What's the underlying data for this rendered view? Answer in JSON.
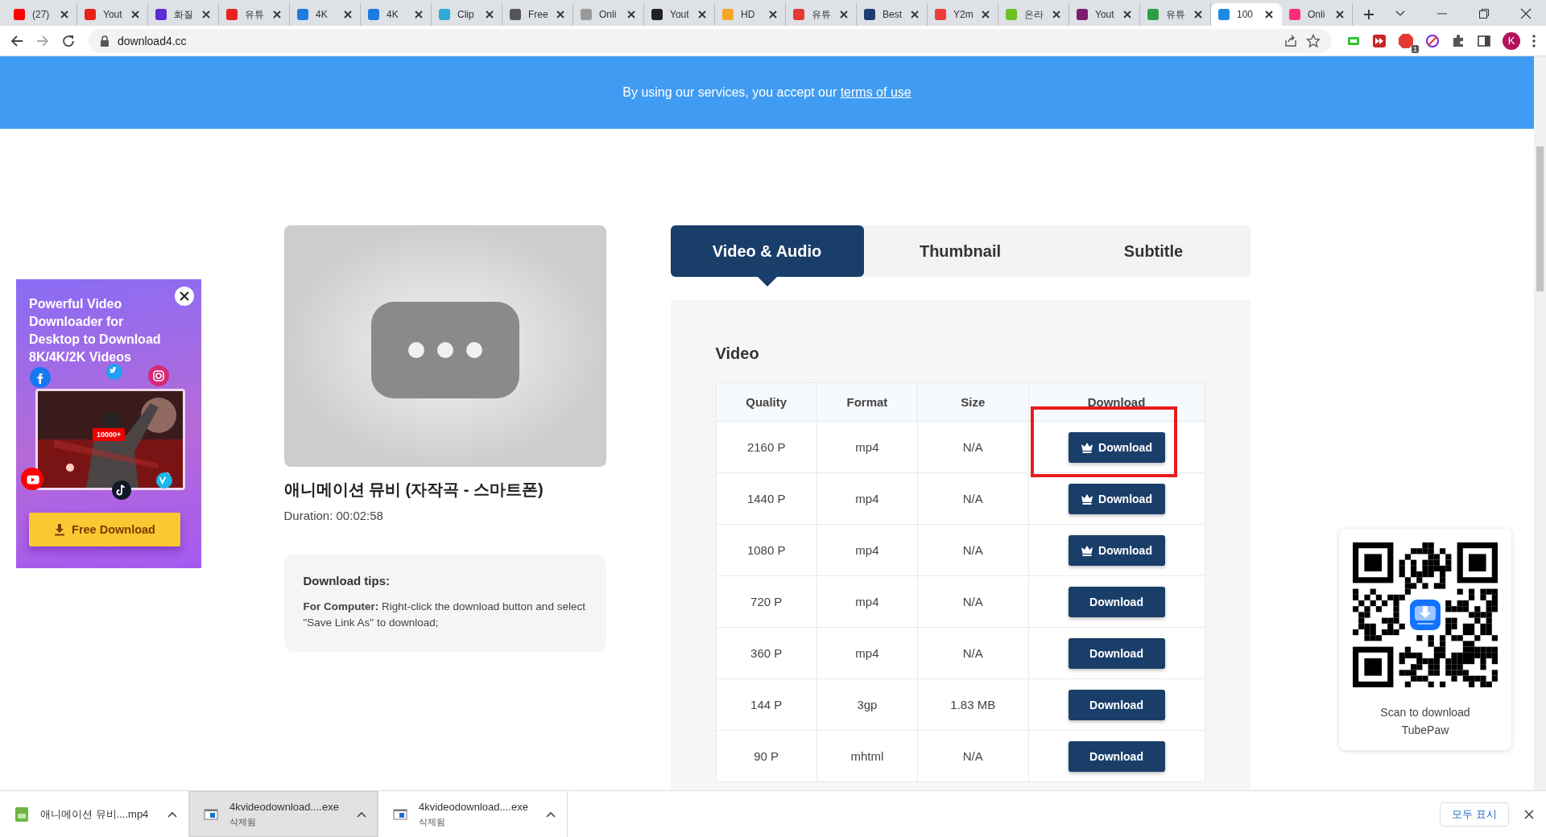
{
  "browser": {
    "tabs": [
      {
        "label": "(27)",
        "selected": false,
        "color": "#ff0000"
      },
      {
        "label": "Yout",
        "selected": false,
        "color": "#e62117"
      },
      {
        "label": "화질",
        "selected": false,
        "color": "#5b2bd6"
      },
      {
        "label": "유튜",
        "selected": false,
        "color": "#e8231d"
      },
      {
        "label": "4K",
        "selected": false,
        "color": "#1e7be0"
      },
      {
        "label": "4K",
        "selected": false,
        "color": "#1e7be0"
      },
      {
        "label": "Clip",
        "selected": false,
        "color": "#2fa9d9"
      },
      {
        "label": "Free",
        "selected": false,
        "color": "#555555"
      },
      {
        "label": "Onli",
        "selected": false,
        "color": "#9a9a9a"
      },
      {
        "label": "Yout",
        "selected": false,
        "color": "#222222"
      },
      {
        "label": "HD",
        "selected": false,
        "color": "#f5a623"
      },
      {
        "label": "유튜",
        "selected": false,
        "color": "#e53935"
      },
      {
        "label": "Best",
        "selected": false,
        "color": "#1f3b73"
      },
      {
        "label": "Y2m",
        "selected": false,
        "color": "#ef3b3b"
      },
      {
        "label": "온라",
        "selected": false,
        "color": "#6cc024"
      },
      {
        "label": "Yout",
        "selected": false,
        "color": "#7a1f6e"
      },
      {
        "label": "유튜",
        "selected": false,
        "color": "#2e9e44"
      },
      {
        "label": "100",
        "selected": true,
        "color": "#1e88e5"
      },
      {
        "label": "Onli",
        "selected": false,
        "color": "#ff2d7a"
      }
    ],
    "url": "download4.cc",
    "extension_badge": "1",
    "profile_initial": "K"
  },
  "banner": {
    "text": "By using our services, you accept our",
    "link": "terms of use"
  },
  "ad": {
    "headline": "Powerful Video Downloader for Desktop to Download 8K/4K/2K Videos",
    "badge": "10000+",
    "button": "Free Download"
  },
  "video": {
    "title": "애니메이션 뮤비 (자작곡 - 스마트폰)",
    "duration": "Duration: 00:02:58"
  },
  "tips": {
    "heading": "Download tips:",
    "text": "**For Computer:** Right-click the download button and select \"Save Link As\" to download;"
  },
  "format_tabs": [
    {
      "label": "Video & Audio",
      "selected": true
    },
    {
      "label": "Thumbnail",
      "selected": false
    },
    {
      "label": "Subtitle",
      "selected": false
    }
  ],
  "video_section": {
    "heading": "Video",
    "columns": [
      "Quality",
      "Format",
      "Size",
      "Download"
    ],
    "rows": [
      {
        "quality": "2160 P",
        "format": "mp4",
        "size": "N/A",
        "button": "Download",
        "premium": true,
        "highlighted": true
      },
      {
        "quality": "1440 P",
        "format": "mp4",
        "size": "N/A",
        "button": "Download",
        "premium": true,
        "highlighted": false
      },
      {
        "quality": "1080 P",
        "format": "mp4",
        "size": "N/A",
        "button": "Download",
        "premium": true,
        "highlighted": false
      },
      {
        "quality": "720 P",
        "format": "mp4",
        "size": "N/A",
        "button": "Download",
        "premium": false,
        "highlighted": false
      },
      {
        "quality": "360 P",
        "format": "mp4",
        "size": "N/A",
        "button": "Download",
        "premium": false,
        "highlighted": false
      },
      {
        "quality": "144 P",
        "format": "3gp",
        "size": "1.83 MB",
        "button": "Download",
        "premium": false,
        "highlighted": false
      },
      {
        "quality": "90 P",
        "format": "mhtml",
        "size": "N/A",
        "button": "Download",
        "premium": false,
        "highlighted": false
      }
    ]
  },
  "qr": {
    "caption": "Scan to download TubePaw"
  },
  "downloads": {
    "items": [
      {
        "kind": "video",
        "name": "애니메이션 뮤비....mp4",
        "hovered": false
      },
      {
        "kind": "installer",
        "name": "4kvideodownload....exe",
        "status": "삭제됨",
        "hovered": true
      },
      {
        "kind": "installer",
        "name": "4kvideodownload....exe",
        "status": "삭제됨",
        "hovered": false
      }
    ],
    "show_all": "모두 표시"
  }
}
